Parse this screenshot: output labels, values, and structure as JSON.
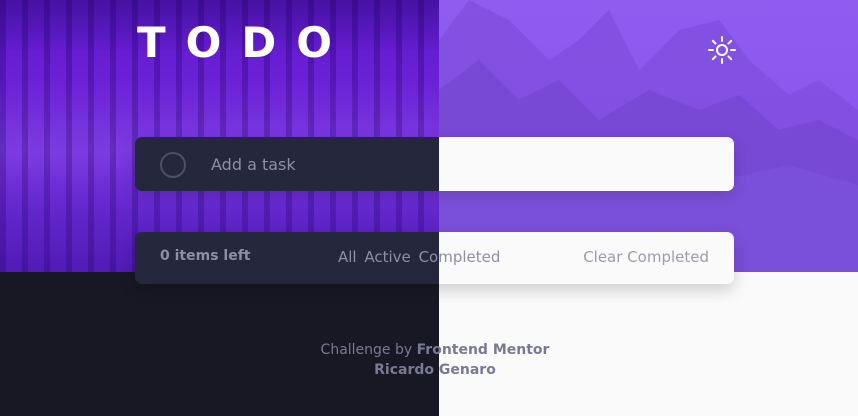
{
  "header": {
    "logo": "TODO",
    "theme_toggle_icon": "sun-icon"
  },
  "new_task": {
    "placeholder": "Add a task",
    "check_icon": "circle-icon"
  },
  "filter_bar": {
    "items_left": "0 items left",
    "filters": [
      "All",
      "Active",
      "Completed"
    ],
    "clear_label": "Clear Completed"
  },
  "footer": {
    "challenge_prefix": "Challenge by",
    "challenge_link": "Frontend Mentor",
    "author": "Ricardo Genaro"
  },
  "colors": {
    "dark_panel": "#25273c",
    "dark_bg": "#181824",
    "light_panel": "#fafafa",
    "accent_purple": "#8f5cf0",
    "muted_text": "#8d8fa3"
  }
}
